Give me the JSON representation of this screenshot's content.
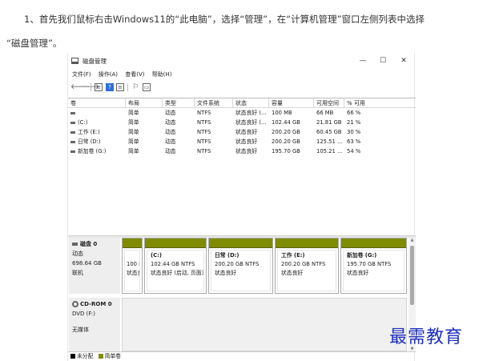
{
  "article": {
    "line1": "1、首先我们鼠标右击Windows11的“此电脑”，选择“管理”，在“计算机管理”窗口左侧列表中选择",
    "line2": "“磁盘管理”。"
  },
  "window": {
    "title": "磁盘管理",
    "controls": {
      "minimize": "—",
      "maximize": "☐",
      "close": "✕"
    }
  },
  "menu": [
    "文件(F)",
    "操作(A)",
    "查看(V)",
    "帮助(H)"
  ],
  "volume_table": {
    "columns": [
      "卷",
      "布局",
      "类型",
      "文件系统",
      "状态",
      "容量",
      "可用空间",
      "% 可用"
    ],
    "rows": [
      [
        "",
        "简单",
        "动态",
        "NTFS",
        "状态良好 (...",
        "100 MB",
        "66 MB",
        "66 %"
      ],
      [
        "(C:)",
        "简单",
        "动态",
        "NTFS",
        "状态良好 (...",
        "102.44 GB",
        "21.81 GB",
        "21 %"
      ],
      [
        "工作 (E:)",
        "简单",
        "动态",
        "NTFS",
        "状态良好",
        "200.20 GB",
        "60.45 GB",
        "30 %"
      ],
      [
        "日常 (D:)",
        "简单",
        "动态",
        "NTFS",
        "状态良好",
        "200.20 GB",
        "125.51 ...",
        "63 %"
      ],
      [
        "新加卷 (G:)",
        "简单",
        "动态",
        "NTFS",
        "状态良好",
        "195.70 GB",
        "105.21 ...",
        "54 %"
      ]
    ]
  },
  "disk0": {
    "name": "磁盘 0",
    "type": "动态",
    "size": "698.64 GB",
    "status": "联机",
    "partitions": [
      {
        "title": "",
        "line1": "100 M",
        "line2": "状态良"
      },
      {
        "title": "(C:)",
        "line1": "102.44 GB NTFS",
        "line2": "状态良好 (启动, 页面3"
      },
      {
        "title": "日常  (D:)",
        "line1": "200.20 GB NTFS",
        "line2": "状态良好"
      },
      {
        "title": "工作  (E:)",
        "line1": "200.20 GB NTFS",
        "line2": "状态良好"
      },
      {
        "title": "新加卷  (G:)",
        "line1": "195.70 GB NTFS",
        "line2": "状态良好"
      }
    ]
  },
  "cdrom0": {
    "name": "CD-ROM 0",
    "drive": "DVD (F:)",
    "status": "无媒体"
  },
  "legend": {
    "unallocated": "未分配",
    "simple": "简单卷",
    "unallocated_color": "#000000",
    "simple_color": "#7f8c00"
  },
  "watermark": "最需教育"
}
